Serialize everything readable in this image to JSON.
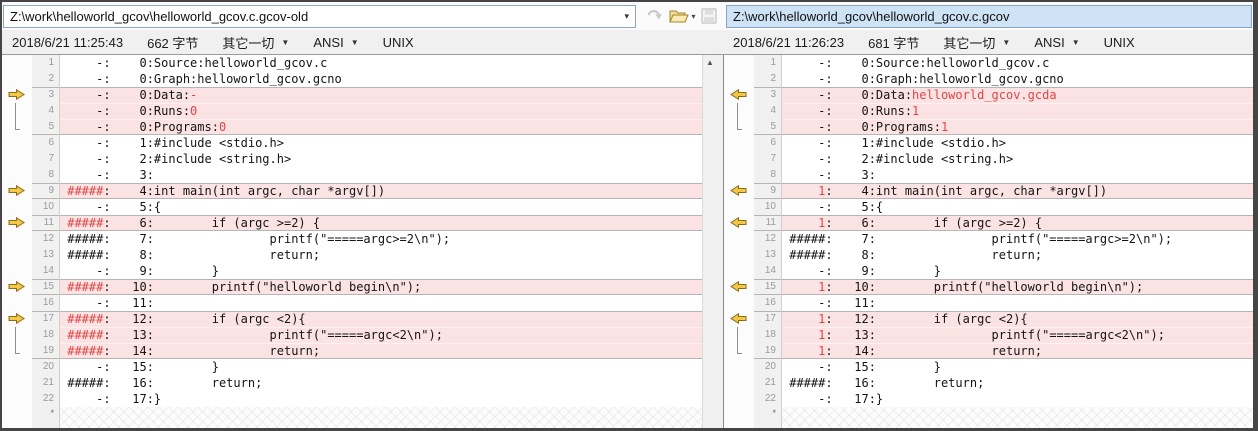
{
  "toolbar": {
    "left_path": "Z:\\work\\helloworld_gcov\\helloworld_gcov.c.gcov-old",
    "right_path": "Z:\\work\\helloworld_gcov\\helloworld_gcov.c.gcov"
  },
  "left_info": {
    "modified": "2018/6/21 11:25:43",
    "size": "662 字节",
    "format": "其它一切",
    "encoding": "ANSI",
    "line_ending": "UNIX"
  },
  "right_info": {
    "modified": "2018/6/21 11:26:23",
    "size": "681 字节",
    "format": "其它一切",
    "encoding": "ANSI",
    "line_ending": "UNIX"
  },
  "icons": {
    "dropdown": "▾",
    "small_dropdown": "▼",
    "scroll_up": "▲",
    "eof_mark": "*"
  },
  "colors": {
    "diff_row": "#fbe3e4",
    "diff_text": "#e04646",
    "selected_path_bg": "#cfe3f7",
    "marker_arrow": "#f6c944"
  },
  "left_lines": [
    {
      "n": 1,
      "sec": "",
      "mark": "",
      "segs": [
        {
          "t": "     -:    0:Source:helloworld_gcov.c"
        }
      ]
    },
    {
      "n": 2,
      "sec": "",
      "mark": "",
      "segs": [
        {
          "t": "     -:    0:Graph:helloworld_gcov.gcno"
        }
      ]
    },
    {
      "n": 3,
      "sec": "start",
      "mark": "arrow",
      "segs": [
        {
          "t": "     -:    0:Data:"
        },
        {
          "t": "-",
          "red": true
        }
      ]
    },
    {
      "n": 4,
      "sec": "mid",
      "mark": "mid",
      "segs": [
        {
          "t": "     -:    0:Runs:"
        },
        {
          "t": "0",
          "red": true
        }
      ]
    },
    {
      "n": 5,
      "sec": "end",
      "mark": "end",
      "segs": [
        {
          "t": "     -:    0:Programs:"
        },
        {
          "t": "0",
          "red": true
        }
      ]
    },
    {
      "n": 6,
      "sec": "",
      "mark": "",
      "segs": [
        {
          "t": "     -:    1:#include <stdio.h>"
        }
      ]
    },
    {
      "n": 7,
      "sec": "",
      "mark": "",
      "segs": [
        {
          "t": "     -:    2:#include <string.h>"
        }
      ]
    },
    {
      "n": 8,
      "sec": "",
      "mark": "",
      "segs": [
        {
          "t": "     -:    3:"
        }
      ]
    },
    {
      "n": 9,
      "sec": "single",
      "mark": "arrow",
      "segs": [
        {
          "t": " "
        },
        {
          "t": "#####",
          "red": true
        },
        {
          "t": ":    4:int main(int argc, char *argv[])"
        }
      ]
    },
    {
      "n": 10,
      "sec": "",
      "mark": "",
      "segs": [
        {
          "t": "     -:    5:{"
        }
      ]
    },
    {
      "n": 11,
      "sec": "single",
      "mark": "arrow",
      "segs": [
        {
          "t": " "
        },
        {
          "t": "#####",
          "red": true
        },
        {
          "t": ":    6:        if (argc >=2) {"
        }
      ]
    },
    {
      "n": 12,
      "sec": "",
      "mark": "",
      "segs": [
        {
          "t": " #####:    7:                printf(\"=====argc>=2\\n\");"
        }
      ]
    },
    {
      "n": 13,
      "sec": "",
      "mark": "",
      "segs": [
        {
          "t": " #####:    8:                return;"
        }
      ]
    },
    {
      "n": 14,
      "sec": "",
      "mark": "",
      "segs": [
        {
          "t": "     -:    9:        }"
        }
      ]
    },
    {
      "n": 15,
      "sec": "single",
      "mark": "arrow",
      "segs": [
        {
          "t": " "
        },
        {
          "t": "#####",
          "red": true
        },
        {
          "t": ":   10:        printf(\"helloworld begin\\n\");"
        }
      ]
    },
    {
      "n": 16,
      "sec": "",
      "mark": "",
      "segs": [
        {
          "t": "     -:   11:"
        }
      ]
    },
    {
      "n": 17,
      "sec": "start",
      "mark": "arrow",
      "segs": [
        {
          "t": " "
        },
        {
          "t": "#####",
          "red": true
        },
        {
          "t": ":   12:        if (argc <2){"
        }
      ]
    },
    {
      "n": 18,
      "sec": "mid",
      "mark": "mid",
      "segs": [
        {
          "t": " "
        },
        {
          "t": "#####",
          "red": true
        },
        {
          "t": ":   13:                printf(\"=====argc<2\\n\");"
        }
      ]
    },
    {
      "n": 19,
      "sec": "end",
      "mark": "end",
      "segs": [
        {
          "t": " "
        },
        {
          "t": "#####",
          "red": true
        },
        {
          "t": ":   14:                return;"
        }
      ]
    },
    {
      "n": 20,
      "sec": "",
      "mark": "",
      "segs": [
        {
          "t": "     -:   15:        }"
        }
      ]
    },
    {
      "n": 21,
      "sec": "",
      "mark": "",
      "segs": [
        {
          "t": " #####:   16:        return;"
        }
      ]
    },
    {
      "n": 22,
      "sec": "",
      "mark": "",
      "segs": [
        {
          "t": "     -:   17:}"
        }
      ]
    }
  ],
  "right_lines": [
    {
      "n": 1,
      "sec": "",
      "mark": "",
      "segs": [
        {
          "t": "     -:    0:Source:helloworld_gcov.c"
        }
      ]
    },
    {
      "n": 2,
      "sec": "",
      "mark": "",
      "segs": [
        {
          "t": "     -:    0:Graph:helloworld_gcov.gcno"
        }
      ]
    },
    {
      "n": 3,
      "sec": "start",
      "mark": "arrow",
      "segs": [
        {
          "t": "     -:    0:Data:"
        },
        {
          "t": "helloworld_gcov.gcda",
          "red": true
        }
      ]
    },
    {
      "n": 4,
      "sec": "mid",
      "mark": "mid",
      "segs": [
        {
          "t": "     -:    0:Runs:"
        },
        {
          "t": "1",
          "red": true
        }
      ]
    },
    {
      "n": 5,
      "sec": "end",
      "mark": "end",
      "segs": [
        {
          "t": "     -:    0:Programs:"
        },
        {
          "t": "1",
          "red": true
        }
      ]
    },
    {
      "n": 6,
      "sec": "",
      "mark": "",
      "segs": [
        {
          "t": "     -:    1:#include <stdio.h>"
        }
      ]
    },
    {
      "n": 7,
      "sec": "",
      "mark": "",
      "segs": [
        {
          "t": "     -:    2:#include <string.h>"
        }
      ]
    },
    {
      "n": 8,
      "sec": "",
      "mark": "",
      "segs": [
        {
          "t": "     -:    3:"
        }
      ]
    },
    {
      "n": 9,
      "sec": "single",
      "mark": "arrow",
      "segs": [
        {
          "t": "     "
        },
        {
          "t": "1",
          "red": true
        },
        {
          "t": ":    4:int main(int argc, char *argv[])"
        }
      ]
    },
    {
      "n": 10,
      "sec": "",
      "mark": "",
      "segs": [
        {
          "t": "     -:    5:{"
        }
      ]
    },
    {
      "n": 11,
      "sec": "single",
      "mark": "arrow",
      "segs": [
        {
          "t": "     "
        },
        {
          "t": "1",
          "red": true
        },
        {
          "t": ":    6:        if (argc >=2) {"
        }
      ]
    },
    {
      "n": 12,
      "sec": "",
      "mark": "",
      "segs": [
        {
          "t": " #####:    7:                printf(\"=====argc>=2\\n\");"
        }
      ]
    },
    {
      "n": 13,
      "sec": "",
      "mark": "",
      "segs": [
        {
          "t": " #####:    8:                return;"
        }
      ]
    },
    {
      "n": 14,
      "sec": "",
      "mark": "",
      "segs": [
        {
          "t": "     -:    9:        }"
        }
      ]
    },
    {
      "n": 15,
      "sec": "single",
      "mark": "arrow",
      "segs": [
        {
          "t": "     "
        },
        {
          "t": "1",
          "red": true
        },
        {
          "t": ":   10:        printf(\"helloworld begin\\n\");"
        }
      ]
    },
    {
      "n": 16,
      "sec": "",
      "mark": "",
      "segs": [
        {
          "t": "     -:   11:"
        }
      ]
    },
    {
      "n": 17,
      "sec": "start",
      "mark": "arrow",
      "segs": [
        {
          "t": "     "
        },
        {
          "t": "1",
          "red": true
        },
        {
          "t": ":   12:        if (argc <2){"
        }
      ]
    },
    {
      "n": 18,
      "sec": "mid",
      "mark": "mid",
      "segs": [
        {
          "t": "     "
        },
        {
          "t": "1",
          "red": true
        },
        {
          "t": ":   13:                printf(\"=====argc<2\\n\");"
        }
      ]
    },
    {
      "n": 19,
      "sec": "end",
      "mark": "end",
      "segs": [
        {
          "t": "     "
        },
        {
          "t": "1",
          "red": true
        },
        {
          "t": ":   14:                return;"
        }
      ]
    },
    {
      "n": 20,
      "sec": "",
      "mark": "",
      "segs": [
        {
          "t": "     -:   15:        }"
        }
      ]
    },
    {
      "n": 21,
      "sec": "",
      "mark": "",
      "segs": [
        {
          "t": " #####:   16:        return;"
        }
      ]
    },
    {
      "n": 22,
      "sec": "",
      "mark": "",
      "segs": [
        {
          "t": "     -:   17:}"
        }
      ]
    }
  ]
}
